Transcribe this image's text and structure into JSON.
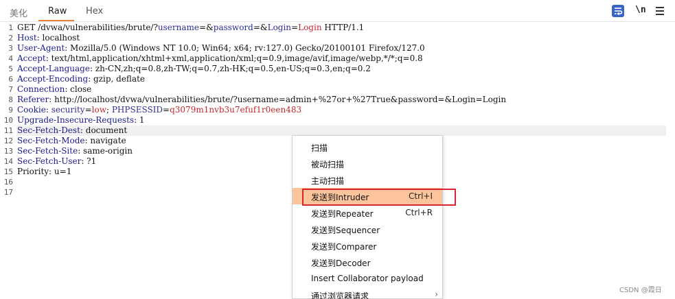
{
  "tabs": [
    {
      "label": "美化"
    },
    {
      "label": "Raw"
    },
    {
      "label": "Hex"
    }
  ],
  "toolbar": {
    "newline_label": "\\n"
  },
  "request": {
    "lines": [
      {
        "n": "1",
        "parts": [
          {
            "t": "GET /dvwa/vulnerabilities/brute/?",
            "c": ""
          },
          {
            "t": "username",
            "c": "pk"
          },
          {
            "t": "=&",
            "c": ""
          },
          {
            "t": "password",
            "c": "pk"
          },
          {
            "t": "=&",
            "c": ""
          },
          {
            "t": "Login",
            "c": "pk"
          },
          {
            "t": "=",
            "c": ""
          },
          {
            "t": "Login",
            "c": "pv"
          },
          {
            "t": " HTTP/1.1",
            "c": ""
          }
        ]
      },
      {
        "n": "2",
        "parts": [
          {
            "t": "Host",
            "c": "hn"
          },
          {
            "t": ": localhost",
            "c": ""
          }
        ]
      },
      {
        "n": "3",
        "parts": [
          {
            "t": "User-Agent",
            "c": "hn"
          },
          {
            "t": ": Mozilla/5.0 (Windows NT 10.0; Win64; x64; rv:127.0) Gecko/20100101 Firefox/127.0",
            "c": ""
          }
        ]
      },
      {
        "n": "4",
        "parts": [
          {
            "t": "Accept",
            "c": "hn"
          },
          {
            "t": ": text/html,application/xhtml+xml,application/xml;q=0.9,image/avif,image/webp,*/*;q=0.8",
            "c": ""
          }
        ]
      },
      {
        "n": "5",
        "parts": [
          {
            "t": "Accept-Language",
            "c": "hn"
          },
          {
            "t": ": zh-CN,zh;q=0.8,zh-TW;q=0.7,zh-HK;q=0.5,en-US;q=0.3,en;q=0.2",
            "c": ""
          }
        ]
      },
      {
        "n": "6",
        "parts": [
          {
            "t": "Accept-Encoding",
            "c": "hn"
          },
          {
            "t": ": gzip, deflate",
            "c": ""
          }
        ]
      },
      {
        "n": "7",
        "parts": [
          {
            "t": "Connection",
            "c": "hn"
          },
          {
            "t": ": close",
            "c": ""
          }
        ]
      },
      {
        "n": "8",
        "parts": [
          {
            "t": "Referer",
            "c": "hn"
          },
          {
            "t": ": http://localhost/dvwa/vulnerabilities/brute/?username=admin+%27or+%27True&password=&Login=Login",
            "c": ""
          }
        ]
      },
      {
        "n": "9",
        "parts": [
          {
            "t": "Cookie",
            "c": "hn"
          },
          {
            "t": ": ",
            "c": ""
          },
          {
            "t": "security",
            "c": "ck"
          },
          {
            "t": "=",
            "c": ""
          },
          {
            "t": "low",
            "c": "cv"
          },
          {
            "t": "; ",
            "c": ""
          },
          {
            "t": "PHPSESSID",
            "c": "ck"
          },
          {
            "t": "=",
            "c": ""
          },
          {
            "t": "q3079m1nvb3u7efuf1r0een483",
            "c": "cv"
          }
        ]
      },
      {
        "n": "10",
        "parts": [
          {
            "t": "Upgrade-Insecure-Requests",
            "c": "hn"
          },
          {
            "t": ": 1",
            "c": ""
          }
        ]
      },
      {
        "n": "11",
        "parts": [
          {
            "t": "Sec-Fetch-Dest",
            "c": "hn"
          },
          {
            "t": ": document",
            "c": ""
          }
        ]
      },
      {
        "n": "12",
        "parts": [
          {
            "t": "Sec-Fetch-Mode",
            "c": "hn"
          },
          {
            "t": ": navigate",
            "c": ""
          }
        ]
      },
      {
        "n": "13",
        "parts": [
          {
            "t": "Sec-Fetch-Site",
            "c": "hn"
          },
          {
            "t": ": same-origin",
            "c": ""
          }
        ]
      },
      {
        "n": "14",
        "parts": [
          {
            "t": "Sec-Fetch-User",
            "c": "hn"
          },
          {
            "t": ": ?1",
            "c": ""
          }
        ]
      },
      {
        "n": "15",
        "parts": [
          {
            "t": "Priority: u=1",
            "c": ""
          }
        ]
      },
      {
        "n": "16",
        "parts": []
      },
      {
        "n": "17",
        "parts": []
      }
    ]
  },
  "context_menu": {
    "items": [
      {
        "label": "扫描",
        "shortcut": ""
      },
      {
        "label": "被动扫描",
        "shortcut": ""
      },
      {
        "label": "主动扫描",
        "shortcut": ""
      },
      {
        "label": "发送到Intruder",
        "shortcut": "Ctrl+I"
      },
      {
        "label": "发送到Repeater",
        "shortcut": "Ctrl+R"
      },
      {
        "label": "发送到Sequencer",
        "shortcut": ""
      },
      {
        "label": "发送到Comparer",
        "shortcut": ""
      },
      {
        "label": "发送到Decoder",
        "shortcut": ""
      },
      {
        "label": "Insert Collaborator payload",
        "shortcut": ""
      },
      {
        "label": "通过浏览器请求",
        "shortcut": ""
      }
    ]
  },
  "watermark": "CSDN @霞日",
  "colors": {
    "accent_tab": "#e8813a",
    "menu_highlight": "#fbc49a",
    "callout_border": "#d9232e",
    "header_name": "#1a1a8a",
    "param_value": "#c0282c"
  }
}
